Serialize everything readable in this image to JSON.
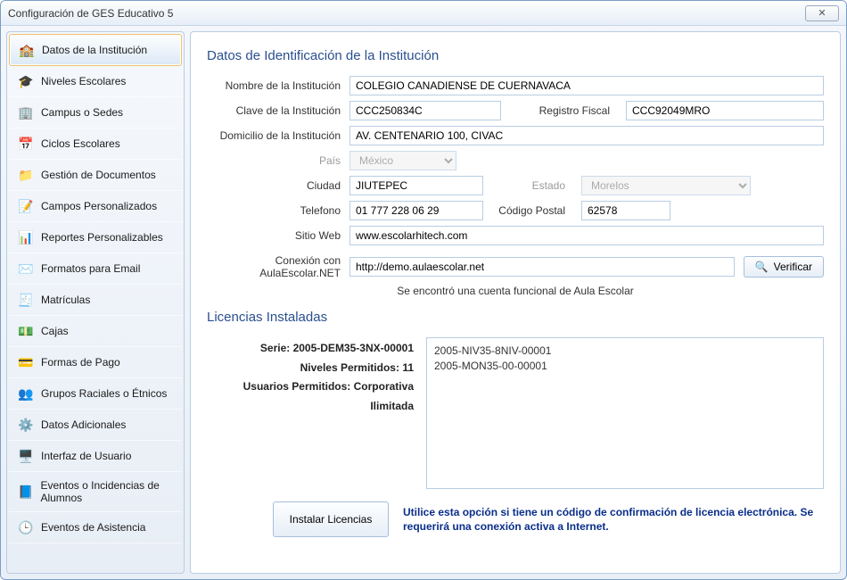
{
  "window": {
    "title": "Configuración de GES Educativo 5",
    "close": "✕"
  },
  "sidebar": {
    "items": [
      {
        "label": "Datos de la Institución",
        "icon": "🏫",
        "active": true
      },
      {
        "label": "Niveles Escolares",
        "icon": "🎓",
        "active": false
      },
      {
        "label": "Campus o Sedes",
        "icon": "🏢",
        "active": false
      },
      {
        "label": "Ciclos Escolares",
        "icon": "📅",
        "active": false
      },
      {
        "label": "Gestión de Documentos",
        "icon": "📁",
        "active": false
      },
      {
        "label": "Campos Personalizados",
        "icon": "📝",
        "active": false
      },
      {
        "label": "Reportes Personalizables",
        "icon": "📊",
        "active": false
      },
      {
        "label": "Formatos para Email",
        "icon": "✉️",
        "active": false
      },
      {
        "label": "Matrículas",
        "icon": "🧾",
        "active": false
      },
      {
        "label": "Cajas",
        "icon": "💵",
        "active": false
      },
      {
        "label": "Formas de Pago",
        "icon": "💳",
        "active": false
      },
      {
        "label": "Grupos Raciales o Étnicos",
        "icon": "👥",
        "active": false
      },
      {
        "label": "Datos Adicionales",
        "icon": "⚙️",
        "active": false
      },
      {
        "label": "Interfaz de Usuario",
        "icon": "🖥️",
        "active": false
      },
      {
        "label": "Eventos o Incidencias de Alumnos",
        "icon": "📘",
        "active": false
      },
      {
        "label": "Eventos de Asistencia",
        "icon": "🕒",
        "active": false
      }
    ]
  },
  "main": {
    "section1_title": "Datos de Identificación de la Institución",
    "labels": {
      "nombre": "Nombre de la Institución",
      "clave": "Clave de la Institución",
      "registro_fiscal": "Registro Fiscal",
      "domicilio": "Domicilio de la Institución",
      "pais": "País",
      "ciudad": "Ciudad",
      "estado": "Estado",
      "telefono": "Telefono",
      "cp": "Código Postal",
      "sitio": "Sitio Web",
      "conexion": "Conexión con AulaEscolar.NET"
    },
    "values": {
      "nombre": "COLEGIO CANADIENSE DE CUERNAVACA",
      "clave": "CCC250834C",
      "registro_fiscal": "CCC92049MRO",
      "domicilio": "AV. CENTENARIO 100, CIVAC",
      "pais": "México",
      "ciudad": "JIUTEPEC",
      "estado": "Morelos",
      "telefono": "01 777 228 06 29",
      "cp": "62578",
      "sitio": "www.escolarhitech.com",
      "conexion": "http://demo.aulaescolar.net"
    },
    "verify_button": "Verificar",
    "status": "Se encontró una cuenta funcional de Aula Escolar",
    "section2_title": "Licencias Instaladas",
    "license_labels": {
      "serie_prefix": "Serie: ",
      "serie_value": "2005-DEM35-3NX-00001",
      "niveles_prefix": "Niveles Permitidos: ",
      "niveles_value": "11",
      "usuarios_prefix": "Usuarios Permitidos: ",
      "usuarios_value": "Corporativa Ilimitada"
    },
    "license_list": [
      "2005-NIV35-8NIV-00001",
      "2005-MON35-00-00001"
    ],
    "install_button": "Instalar Licencias",
    "install_note": "Utilice esta opción si tiene un código de confirmación de licencia electrónica. Se requerirá una conexión activa a Internet."
  }
}
